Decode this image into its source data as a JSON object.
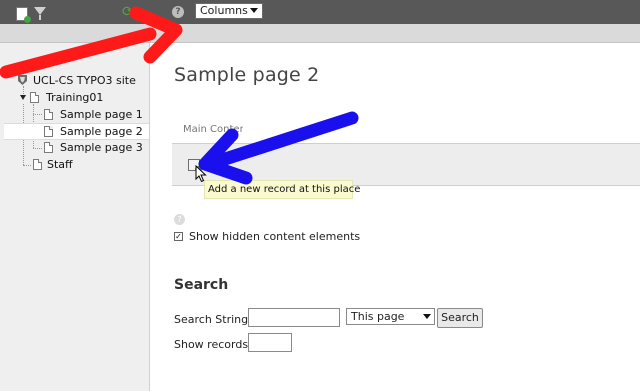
{
  "topbar": {
    "new_page_icon": "new-page-icon",
    "filter_icon": "filter-icon",
    "refresh_icon": "refresh-icon",
    "help_icon": "help-icon",
    "columns_select": {
      "value": "Columns"
    }
  },
  "subbar": {
    "view_icon": "view-page-icon",
    "edit_icon": "edit-page-icon"
  },
  "tree": {
    "root": {
      "label": "UCL-CS TYPO3 site",
      "icon": "typo3-globe-icon"
    },
    "items": [
      {
        "label": "Training01",
        "expanded": true
      },
      {
        "label": "Sample page 1"
      },
      {
        "label": "Sample page 2",
        "selected": true
      },
      {
        "label": "Sample page 3"
      },
      {
        "label": "Staff"
      }
    ]
  },
  "main": {
    "title": "Sample page 2",
    "column_header": "Main Content",
    "new_record_tooltip": "Add a new record at this place",
    "show_hidden_label": "Show hidden content elements",
    "show_hidden_checked": true
  },
  "search": {
    "heading": "Search",
    "string_label": "Search String:",
    "string_value": "",
    "scope_value": "This page",
    "button_label": "Search",
    "records_label": "Show records:",
    "records_value": ""
  },
  "annotations": {
    "red_arrow_color": "#ff1a1a",
    "blue_arrow_color": "#1a10ee"
  }
}
